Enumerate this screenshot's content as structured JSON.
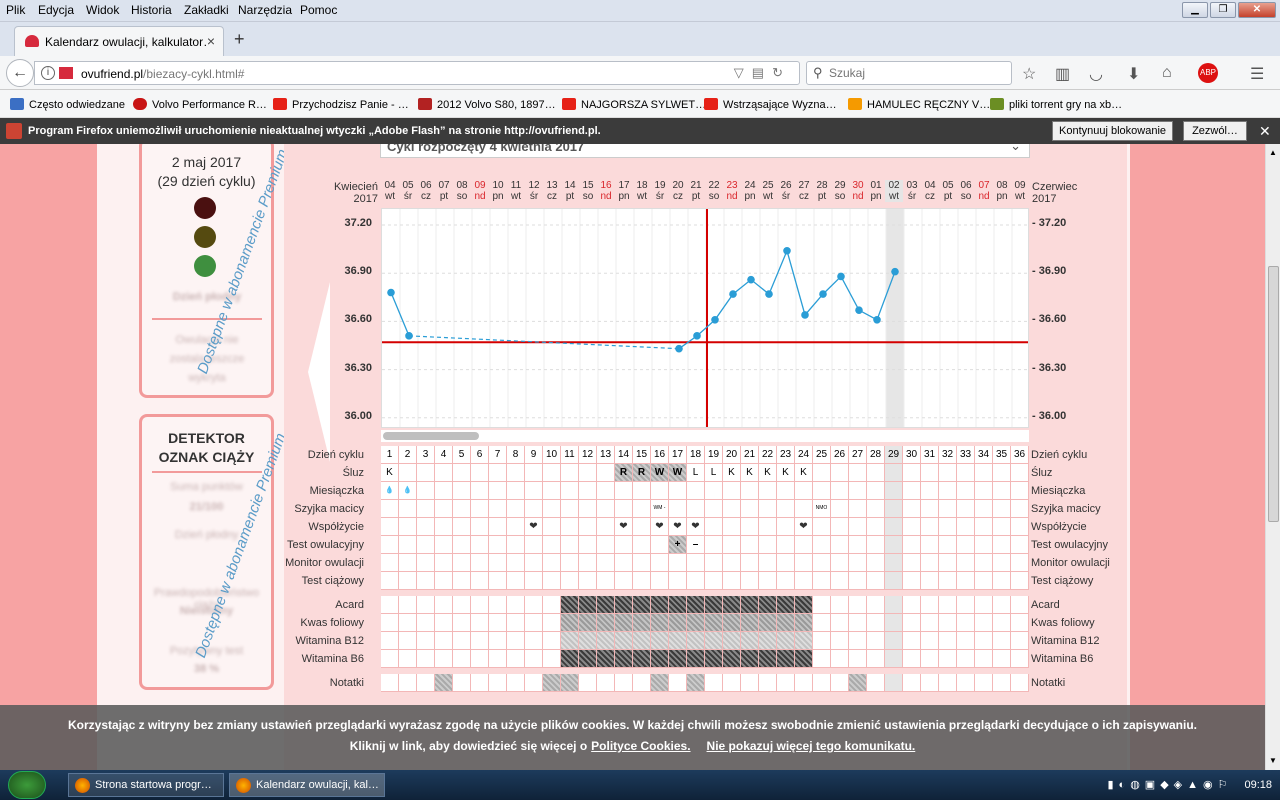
{
  "menubar": {
    "items": [
      "Plik",
      "Edycja",
      "Widok",
      "Historia",
      "Zakładki",
      "Narzędzia",
      "Pomoc"
    ]
  },
  "tab": {
    "title": "Kalendarz owulacji, kalkulator…",
    "new_tab": "+"
  },
  "navbar": {
    "url_host": "ovufriend.pl",
    "url_path": "/biezacy-cykl.html#",
    "search_placeholder": "Szukaj"
  },
  "bookmarks": [
    {
      "label": "Często odwiedzane",
      "color": "#3b6fc4"
    },
    {
      "label": "Volvo Performance R…",
      "color": "#c81414"
    },
    {
      "label": "Przychodzisz Panie - …",
      "color": "#e62117"
    },
    {
      "label": "2012 Volvo S80, 1897…",
      "color": "#b22222"
    },
    {
      "label": "NAJGORSZA SYLWET…",
      "color": "#e62117"
    },
    {
      "label": "Wstrząsające Wyzna…",
      "color": "#e62117"
    },
    {
      "label": "HAMULEC RĘCZNY V…",
      "color": "#f59a00"
    },
    {
      "label": "pliki torrent gry na xb…",
      "color": "#6b8e23"
    }
  ],
  "notification": {
    "text": "Program Firefox uniemożliwił uruchomienie nieaktualnej wtyczki „Adobe Flash” na stronie http://ovufriend.pl.",
    "continue_btn": "Kontynuuj blokowanie",
    "allow_btn": "Zezwól…"
  },
  "left": {
    "date": "2 maj 2017",
    "cycle_day": "(29 dzień cyklu)",
    "blur1": "Dzień płodny",
    "blur2": "Owulacja nie zostala jeszcze wykryta",
    "detector_title": "DETEKTOR OZNAK CIĄŻY",
    "blur3": "Suma punktów",
    "blur4": "21/100",
    "blur5": "Dzień płodny",
    "premium1": "Dostępne w abonamencie Premium",
    "premium2": "Dostępne w abonamencie Premium",
    "blur6": "Prawdopodobieństwo ciąży",
    "blur7": "Nieistotny",
    "blur8": "Pozytywny test",
    "blur9": "38 %"
  },
  "chart": {
    "dropdown": "Cykl rozpoczęty 4 kwietnia 2017",
    "left_month": "Kwiecień 2017",
    "right_month": "Czerwiec 2017",
    "days": [
      [
        "04",
        "wt",
        0
      ],
      [
        "05",
        "śr",
        0
      ],
      [
        "06",
        "cz",
        0
      ],
      [
        "07",
        "pt",
        0
      ],
      [
        "08",
        "so",
        0
      ],
      [
        "09",
        "nd",
        1
      ],
      [
        "10",
        "pn",
        0
      ],
      [
        "11",
        "wt",
        0
      ],
      [
        "12",
        "śr",
        0
      ],
      [
        "13",
        "cz",
        0
      ],
      [
        "14",
        "pt",
        0
      ],
      [
        "15",
        "so",
        0
      ],
      [
        "16",
        "nd",
        1
      ],
      [
        "17",
        "pn",
        0
      ],
      [
        "18",
        "wt",
        0
      ],
      [
        "19",
        "śr",
        0
      ],
      [
        "20",
        "cz",
        0
      ],
      [
        "21",
        "pt",
        0
      ],
      [
        "22",
        "so",
        0
      ],
      [
        "23",
        "nd",
        1
      ],
      [
        "24",
        "pn",
        0
      ],
      [
        "25",
        "wt",
        0
      ],
      [
        "26",
        "śr",
        0
      ],
      [
        "27",
        "cz",
        0
      ],
      [
        "28",
        "pt",
        0
      ],
      [
        "29",
        "so",
        0
      ],
      [
        "30",
        "nd",
        1
      ],
      [
        "01",
        "pn",
        0
      ],
      [
        "02",
        "wt",
        0
      ],
      [
        "03",
        "śr",
        0
      ],
      [
        "04",
        "cz",
        0
      ],
      [
        "05",
        "pt",
        0
      ],
      [
        "06",
        "so",
        0
      ],
      [
        "07",
        "nd",
        1
      ],
      [
        "08",
        "pn",
        0
      ],
      [
        "09",
        "wt",
        0
      ]
    ],
    "yticks": [
      "37.20",
      "36.90",
      "36.60",
      "36.30",
      "36.00"
    ],
    "yticks_right": [
      "- 37.20",
      "- 36.90",
      "- 36.60",
      "- 36.30",
      "- 36.00"
    ],
    "temps": [
      {
        "day": 1,
        "t": 36.78
      },
      {
        "day": 2,
        "t": 36.51
      },
      {
        "day": 17,
        "t": 36.43
      },
      {
        "day": 18,
        "t": 36.51
      },
      {
        "day": 19,
        "t": 36.61
      },
      {
        "day": 20,
        "t": 36.77
      },
      {
        "day": 21,
        "t": 36.86
      },
      {
        "day": 22,
        "t": 36.77
      },
      {
        "day": 23,
        "t": 37.04
      },
      {
        "day": 24,
        "t": 36.64
      },
      {
        "day": 25,
        "t": 36.77
      },
      {
        "day": 26,
        "t": 36.88
      },
      {
        "day": 27,
        "t": 36.67
      },
      {
        "day": 28,
        "t": 36.61
      },
      {
        "day": 29,
        "t": 36.91
      }
    ],
    "coverline": 36.47,
    "ovulation_day": 19,
    "today_day": 29
  },
  "grid": {
    "row_labels": [
      "Dzień cyklu",
      "Śluz",
      "Miesiączka",
      "Szyjka macicy",
      "Współżycie",
      "Test owulacyjny",
      "Monitor owulacji",
      "Test ciążowy",
      "Acard",
      "Kwas foliowy",
      "Witamina B12",
      "Witamina B6",
      "Notatki"
    ],
    "sluz": {
      "1": "K",
      "14": "R",
      "15": "R",
      "16": "W",
      "17": "W",
      "18": "L",
      "19": "L",
      "20": "K",
      "21": "K",
      "22": "K",
      "23": "K",
      "24": "K"
    },
    "szyjka": {
      "16": "WM -",
      "25": "NMO"
    },
    "test_ow": {
      "17": "+",
      "18": "–"
    }
  },
  "cookie": {
    "line1": "Korzystając z witryny bez zmiany ustawień przeglądarki wyrażasz zgodę na użycie plików cookies. W każdej chwili możesz swobodnie zmienić ustawienia przeglądarki decydujące o ich zapisywaniu.",
    "line2": "Kliknij w link, aby dowiedzieć się więcej o",
    "policy_link": "Polityce Cookies.",
    "dismiss_link": "Nie pokazuj więcej tego komunikatu."
  },
  "taskbar": {
    "item1": "Strona startowa progr…",
    "item2": "Kalendarz owulacji, kal…",
    "clock": "09:18"
  }
}
